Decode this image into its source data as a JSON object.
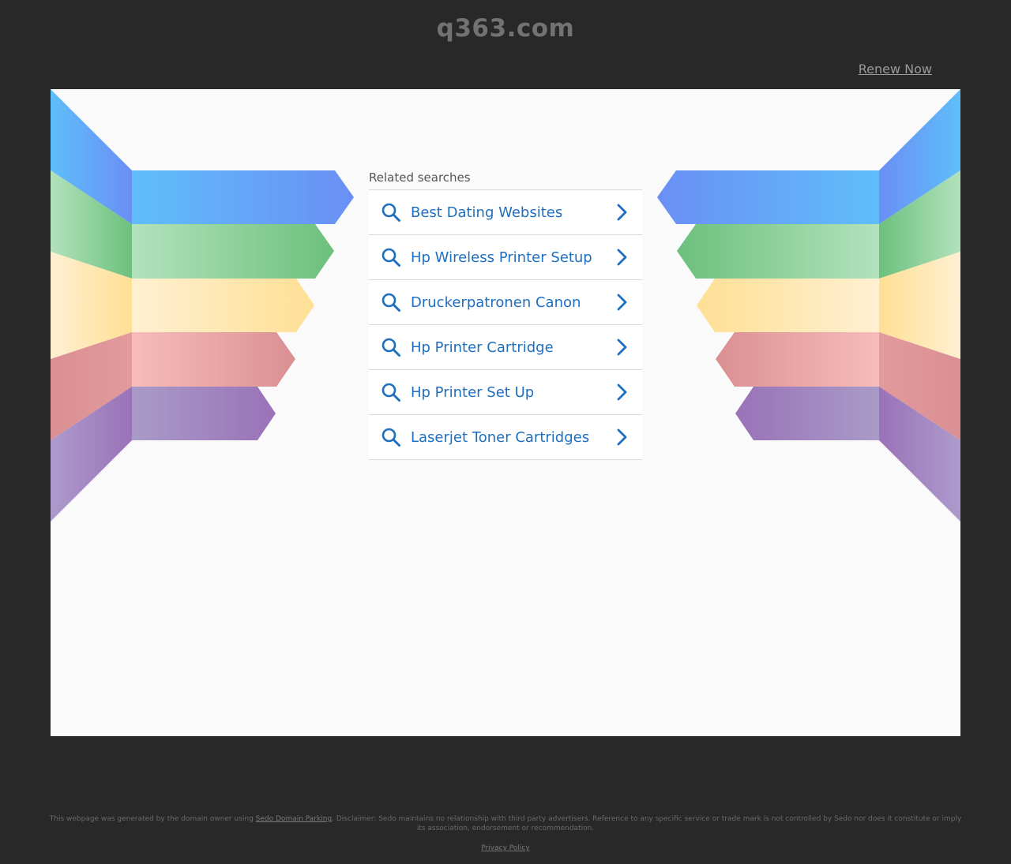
{
  "header": {
    "domain": "q363.com",
    "renew_label": "Renew Now"
  },
  "searches": {
    "heading": "Related searches",
    "items": [
      {
        "label": "Best Dating Websites"
      },
      {
        "label": "Hp Wireless Printer Setup"
      },
      {
        "label": "Druckerpatronen Canon"
      },
      {
        "label": "Hp Printer Cartridge"
      },
      {
        "label": "Hp Printer Set Up"
      },
      {
        "label": "Laserjet Toner Cartridges"
      }
    ]
  },
  "footer": {
    "disclaimer_prefix": "This webpage was generated by the domain owner using ",
    "parking_link": "Sedo Domain Parking",
    "disclaimer_suffix": ". Disclaimer: Sedo maintains no relationship with third party advertisers. Reference to any specific service or trade mark is not controlled by Sedo nor does it constitute or imply its association, endorsement or recommendation.",
    "privacy_label": "Privacy Policy"
  },
  "colors": {
    "background": "#282828",
    "panel": "#fafafa",
    "link_blue": "#1f6fbf",
    "ribbon_blue": "#5fbef9",
    "ribbon_blue_dark": "#6a8ff5",
    "ribbon_green": "#b3e2bc",
    "ribbon_green_dark": "#6cc07d",
    "ribbon_yellow": "#fff0d2",
    "ribbon_yellow_dark": "#fedf94",
    "ribbon_red": "#f7bcbb",
    "ribbon_red_dark": "#da9092",
    "ribbon_purple": "#a99bc8",
    "ribbon_purple_dark": "#9a72b8"
  }
}
